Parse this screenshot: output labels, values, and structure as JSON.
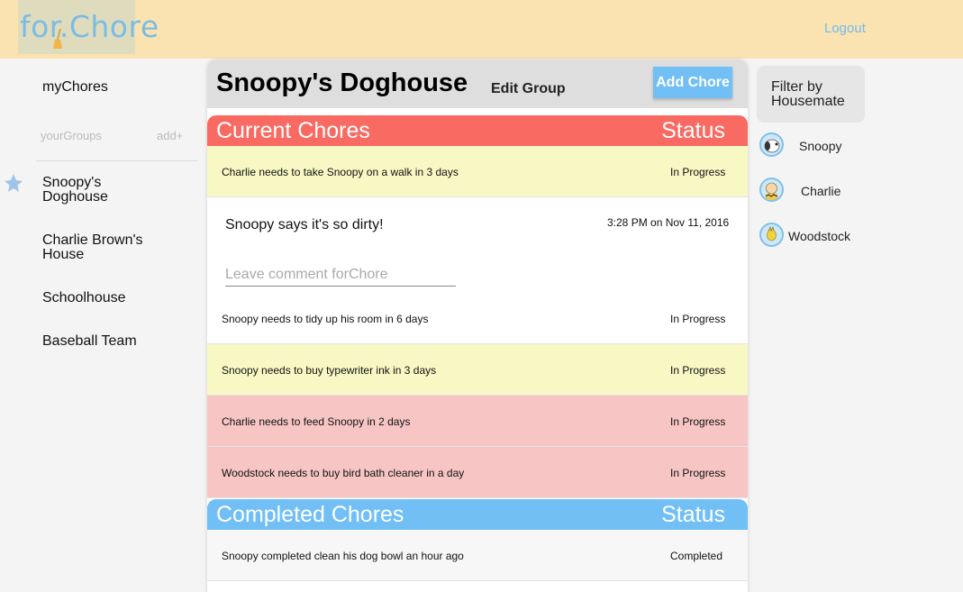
{
  "header": {
    "logo_text": "for.Chore",
    "logout_label": "Logout"
  },
  "sidebar": {
    "my_chores_label": "myChores",
    "groups_heading": "yourGroups",
    "add_label": "add+",
    "groups": [
      {
        "label": "Snoopy's Doghouse"
      },
      {
        "label": "Charlie Brown's House"
      },
      {
        "label": "Schoolhouse"
      },
      {
        "label": "Baseball Team"
      }
    ]
  },
  "group": {
    "title": "Snoopy's Doghouse",
    "edit_label": "Edit Group",
    "add_chore_label": "Add Chore"
  },
  "current": {
    "heading": "Current Chores",
    "status_heading": "Status",
    "rows": [
      {
        "text": "Charlie needs to take Snoopy on a walk in 3 days",
        "status": "In Progress"
      },
      {
        "text": "Snoopy needs to tidy up his room in 6 days",
        "status": "In Progress"
      },
      {
        "text": "Snoopy needs to buy typewriter ink in 3 days",
        "status": "In Progress"
      },
      {
        "text": "Charlie needs to feed Snoopy in 2 days",
        "status": "In Progress"
      },
      {
        "text": "Woodstock needs to buy bird bath cleaner in a day",
        "status": "In Progress"
      }
    ]
  },
  "comment": {
    "text": "Snoopy says it's so dirty!",
    "time": "3:28 PM on Nov 11, 2016",
    "placeholder": "Leave comment forChore"
  },
  "completed": {
    "heading": "Completed Chores",
    "status_heading": "Status",
    "rows": [
      {
        "text": "Snoopy completed clean his dog bowl an hour ago",
        "status": "Completed"
      }
    ]
  },
  "filter": {
    "label": "Filter by Housemate",
    "housemates": [
      {
        "name": "Snoopy"
      },
      {
        "name": "Charlie"
      },
      {
        "name": "Woodstock"
      }
    ]
  },
  "colors": {
    "header_bg": "#fbe3b1",
    "accent_blue": "#71bff5",
    "current_red": "#f86a62",
    "row_yellow": "#f8f8c4",
    "row_pink": "#f7c6c4"
  }
}
